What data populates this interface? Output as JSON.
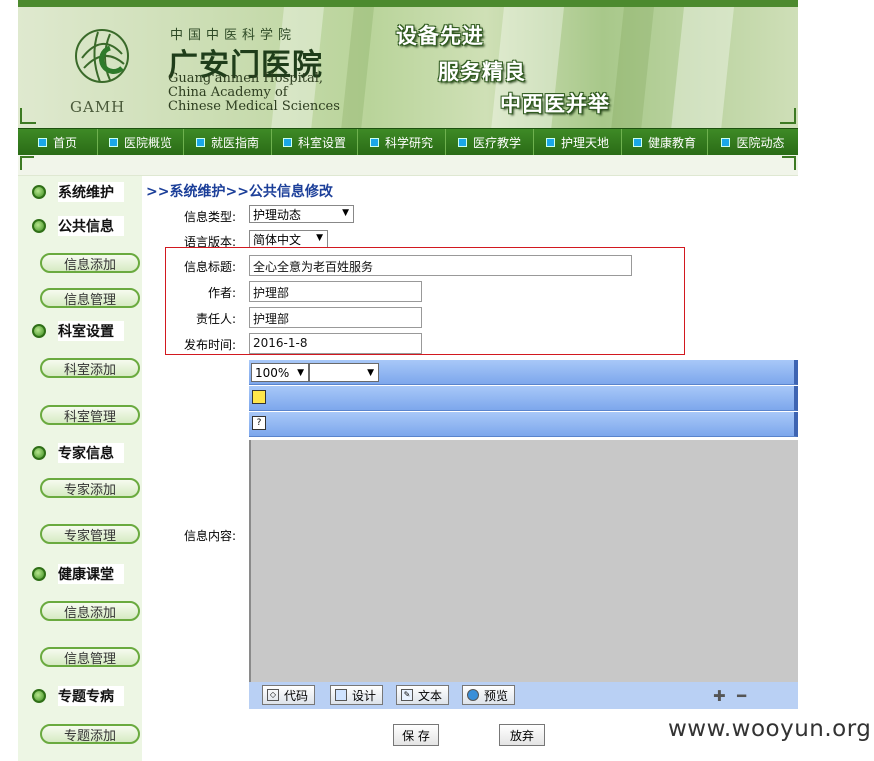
{
  "header": {
    "org_small": "中国中医科学院",
    "hospital_name": "广安门医院",
    "en_line1": "Guang'anmen Hospital,",
    "en_line2": "China Academy of",
    "en_line3": "Chinese Medical Sciences",
    "logo_text": "GAMH",
    "slogans": [
      "设备先进",
      "服务精良",
      "中西医并举"
    ]
  },
  "nav": {
    "items": [
      "首页",
      "医院概览",
      "就医指南",
      "科室设置",
      "科学研究",
      "医疗教学",
      "护理天地",
      "健康教育",
      "医院动态"
    ]
  },
  "sidebar": {
    "sections": [
      {
        "title": "系统维护",
        "items": []
      },
      {
        "title": "公共信息",
        "items": [
          "信息添加",
          "信息管理"
        ]
      },
      {
        "title": "科室设置",
        "items": [
          "科室添加",
          "科室管理"
        ]
      },
      {
        "title": "专家信息",
        "items": [
          "专家添加",
          "专家管理"
        ]
      },
      {
        "title": "健康课堂",
        "items": [
          "信息添加",
          "信息管理"
        ]
      },
      {
        "title": "专题专病",
        "items": [
          "专题添加"
        ]
      }
    ]
  },
  "main": {
    "breadcrumb": ">>系统维护>>公共信息修改",
    "form": {
      "type_label": "信息类型:",
      "type_value": "护理动态",
      "lang_label": "语言版本:",
      "lang_value": "简体中文",
      "title_label": "信息标题:",
      "title_value": "全心全意为老百姓服务",
      "author_label": "作者:",
      "author_value": "护理部",
      "owner_label": "责任人:",
      "owner_value": "护理部",
      "date_label": "发布时间:",
      "date_value": "2016-1-8",
      "content_label": "信息内容:"
    },
    "editor": {
      "zoom_value": "100%",
      "modes": [
        "代码",
        "设计",
        "文本",
        "预览"
      ]
    },
    "save_label": "保 存",
    "cancel_label": "放弃"
  },
  "watermark": "www.wooyun.org",
  "colors": {
    "nav_green": "#2f7519",
    "breadcrumb_blue": "#1c3f99",
    "highlight_red": "#d2181f",
    "editor_blue": "#8fb3f0"
  }
}
